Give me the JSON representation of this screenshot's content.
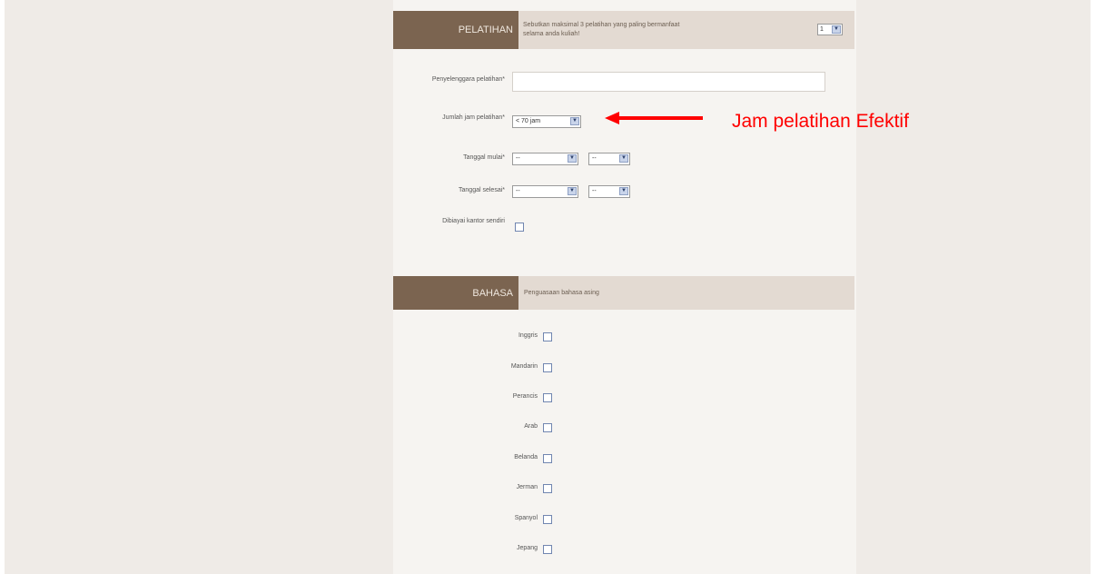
{
  "pelatihan": {
    "title": "PELATIHAN",
    "description": "Sebutkan maksimal 3 pelatihan yang paling bermanfaat selama anda kuliah!",
    "count_value": "1",
    "fields": {
      "penyelenggara_label": "Penyelenggara pelatihan*",
      "penyelenggara_value": "",
      "jumlah_jam_label": "Jumlah jam pelatihan*",
      "jumlah_jam_value": "< 70 jam",
      "tanggal_mulai_label": "Tanggal mulai*",
      "tanggal_selesai_label": "Tanggal selesai*",
      "month_value": "--",
      "year_value": "--",
      "dibiayai_label": "Dibiayai kantor sendiri"
    }
  },
  "bahasa": {
    "title": "BAHASA",
    "description": "Penguasaan bahasa asing",
    "languages": [
      "Inggris",
      "Mandarin",
      "Perancis",
      "Arab",
      "Belanda",
      "Jerman",
      "Spanyol",
      "Jepang"
    ]
  },
  "annotation": {
    "text": "Jam pelatihan Efektif",
    "color": "#ff0000"
  },
  "colors": {
    "header_dark": "#7b6450",
    "header_light": "#e3dad2",
    "panel_bg": "#f6f4f1",
    "page_bg": "#efebe7"
  }
}
